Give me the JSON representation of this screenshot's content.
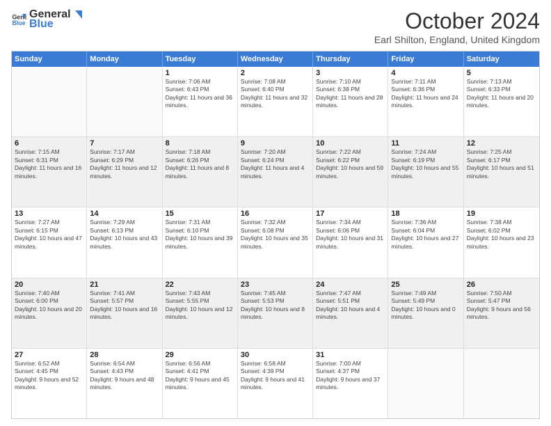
{
  "logo": {
    "general": "General",
    "blue": "Blue"
  },
  "title": "October 2024",
  "location": "Earl Shilton, England, United Kingdom",
  "days_of_week": [
    "Sunday",
    "Monday",
    "Tuesday",
    "Wednesday",
    "Thursday",
    "Friday",
    "Saturday"
  ],
  "weeks": [
    [
      {
        "day": "",
        "sunrise": "",
        "sunset": "",
        "daylight": ""
      },
      {
        "day": "",
        "sunrise": "",
        "sunset": "",
        "daylight": ""
      },
      {
        "day": "1",
        "sunrise": "Sunrise: 7:06 AM",
        "sunset": "Sunset: 6:43 PM",
        "daylight": "Daylight: 11 hours and 36 minutes."
      },
      {
        "day": "2",
        "sunrise": "Sunrise: 7:08 AM",
        "sunset": "Sunset: 6:40 PM",
        "daylight": "Daylight: 11 hours and 32 minutes."
      },
      {
        "day": "3",
        "sunrise": "Sunrise: 7:10 AM",
        "sunset": "Sunset: 6:38 PM",
        "daylight": "Daylight: 11 hours and 28 minutes."
      },
      {
        "day": "4",
        "sunrise": "Sunrise: 7:11 AM",
        "sunset": "Sunset: 6:36 PM",
        "daylight": "Daylight: 11 hours and 24 minutes."
      },
      {
        "day": "5",
        "sunrise": "Sunrise: 7:13 AM",
        "sunset": "Sunset: 6:33 PM",
        "daylight": "Daylight: 11 hours and 20 minutes."
      }
    ],
    [
      {
        "day": "6",
        "sunrise": "Sunrise: 7:15 AM",
        "sunset": "Sunset: 6:31 PM",
        "daylight": "Daylight: 11 hours and 16 minutes."
      },
      {
        "day": "7",
        "sunrise": "Sunrise: 7:17 AM",
        "sunset": "Sunset: 6:29 PM",
        "daylight": "Daylight: 11 hours and 12 minutes."
      },
      {
        "day": "8",
        "sunrise": "Sunrise: 7:18 AM",
        "sunset": "Sunset: 6:26 PM",
        "daylight": "Daylight: 11 hours and 8 minutes."
      },
      {
        "day": "9",
        "sunrise": "Sunrise: 7:20 AM",
        "sunset": "Sunset: 6:24 PM",
        "daylight": "Daylight: 11 hours and 4 minutes."
      },
      {
        "day": "10",
        "sunrise": "Sunrise: 7:22 AM",
        "sunset": "Sunset: 6:22 PM",
        "daylight": "Daylight: 10 hours and 59 minutes."
      },
      {
        "day": "11",
        "sunrise": "Sunrise: 7:24 AM",
        "sunset": "Sunset: 6:19 PM",
        "daylight": "Daylight: 10 hours and 55 minutes."
      },
      {
        "day": "12",
        "sunrise": "Sunrise: 7:25 AM",
        "sunset": "Sunset: 6:17 PM",
        "daylight": "Daylight: 10 hours and 51 minutes."
      }
    ],
    [
      {
        "day": "13",
        "sunrise": "Sunrise: 7:27 AM",
        "sunset": "Sunset: 6:15 PM",
        "daylight": "Daylight: 10 hours and 47 minutes."
      },
      {
        "day": "14",
        "sunrise": "Sunrise: 7:29 AM",
        "sunset": "Sunset: 6:13 PM",
        "daylight": "Daylight: 10 hours and 43 minutes."
      },
      {
        "day": "15",
        "sunrise": "Sunrise: 7:31 AM",
        "sunset": "Sunset: 6:10 PM",
        "daylight": "Daylight: 10 hours and 39 minutes."
      },
      {
        "day": "16",
        "sunrise": "Sunrise: 7:32 AM",
        "sunset": "Sunset: 6:08 PM",
        "daylight": "Daylight: 10 hours and 35 minutes."
      },
      {
        "day": "17",
        "sunrise": "Sunrise: 7:34 AM",
        "sunset": "Sunset: 6:06 PM",
        "daylight": "Daylight: 10 hours and 31 minutes."
      },
      {
        "day": "18",
        "sunrise": "Sunrise: 7:36 AM",
        "sunset": "Sunset: 6:04 PM",
        "daylight": "Daylight: 10 hours and 27 minutes."
      },
      {
        "day": "19",
        "sunrise": "Sunrise: 7:38 AM",
        "sunset": "Sunset: 6:02 PM",
        "daylight": "Daylight: 10 hours and 23 minutes."
      }
    ],
    [
      {
        "day": "20",
        "sunrise": "Sunrise: 7:40 AM",
        "sunset": "Sunset: 6:00 PM",
        "daylight": "Daylight: 10 hours and 20 minutes."
      },
      {
        "day": "21",
        "sunrise": "Sunrise: 7:41 AM",
        "sunset": "Sunset: 5:57 PM",
        "daylight": "Daylight: 10 hours and 16 minutes."
      },
      {
        "day": "22",
        "sunrise": "Sunrise: 7:43 AM",
        "sunset": "Sunset: 5:55 PM",
        "daylight": "Daylight: 10 hours and 12 minutes."
      },
      {
        "day": "23",
        "sunrise": "Sunrise: 7:45 AM",
        "sunset": "Sunset: 5:53 PM",
        "daylight": "Daylight: 10 hours and 8 minutes."
      },
      {
        "day": "24",
        "sunrise": "Sunrise: 7:47 AM",
        "sunset": "Sunset: 5:51 PM",
        "daylight": "Daylight: 10 hours and 4 minutes."
      },
      {
        "day": "25",
        "sunrise": "Sunrise: 7:49 AM",
        "sunset": "Sunset: 5:49 PM",
        "daylight": "Daylight: 10 hours and 0 minutes."
      },
      {
        "day": "26",
        "sunrise": "Sunrise: 7:50 AM",
        "sunset": "Sunset: 5:47 PM",
        "daylight": "Daylight: 9 hours and 56 minutes."
      }
    ],
    [
      {
        "day": "27",
        "sunrise": "Sunrise: 6:52 AM",
        "sunset": "Sunset: 4:45 PM",
        "daylight": "Daylight: 9 hours and 52 minutes."
      },
      {
        "day": "28",
        "sunrise": "Sunrise: 6:54 AM",
        "sunset": "Sunset: 4:43 PM",
        "daylight": "Daylight: 9 hours and 48 minutes."
      },
      {
        "day": "29",
        "sunrise": "Sunrise: 6:56 AM",
        "sunset": "Sunset: 4:41 PM",
        "daylight": "Daylight: 9 hours and 45 minutes."
      },
      {
        "day": "30",
        "sunrise": "Sunrise: 6:58 AM",
        "sunset": "Sunset: 4:39 PM",
        "daylight": "Daylight: 9 hours and 41 minutes."
      },
      {
        "day": "31",
        "sunrise": "Sunrise: 7:00 AM",
        "sunset": "Sunset: 4:37 PM",
        "daylight": "Daylight: 9 hours and 37 minutes."
      },
      {
        "day": "",
        "sunrise": "",
        "sunset": "",
        "daylight": ""
      },
      {
        "day": "",
        "sunrise": "",
        "sunset": "",
        "daylight": ""
      }
    ]
  ]
}
